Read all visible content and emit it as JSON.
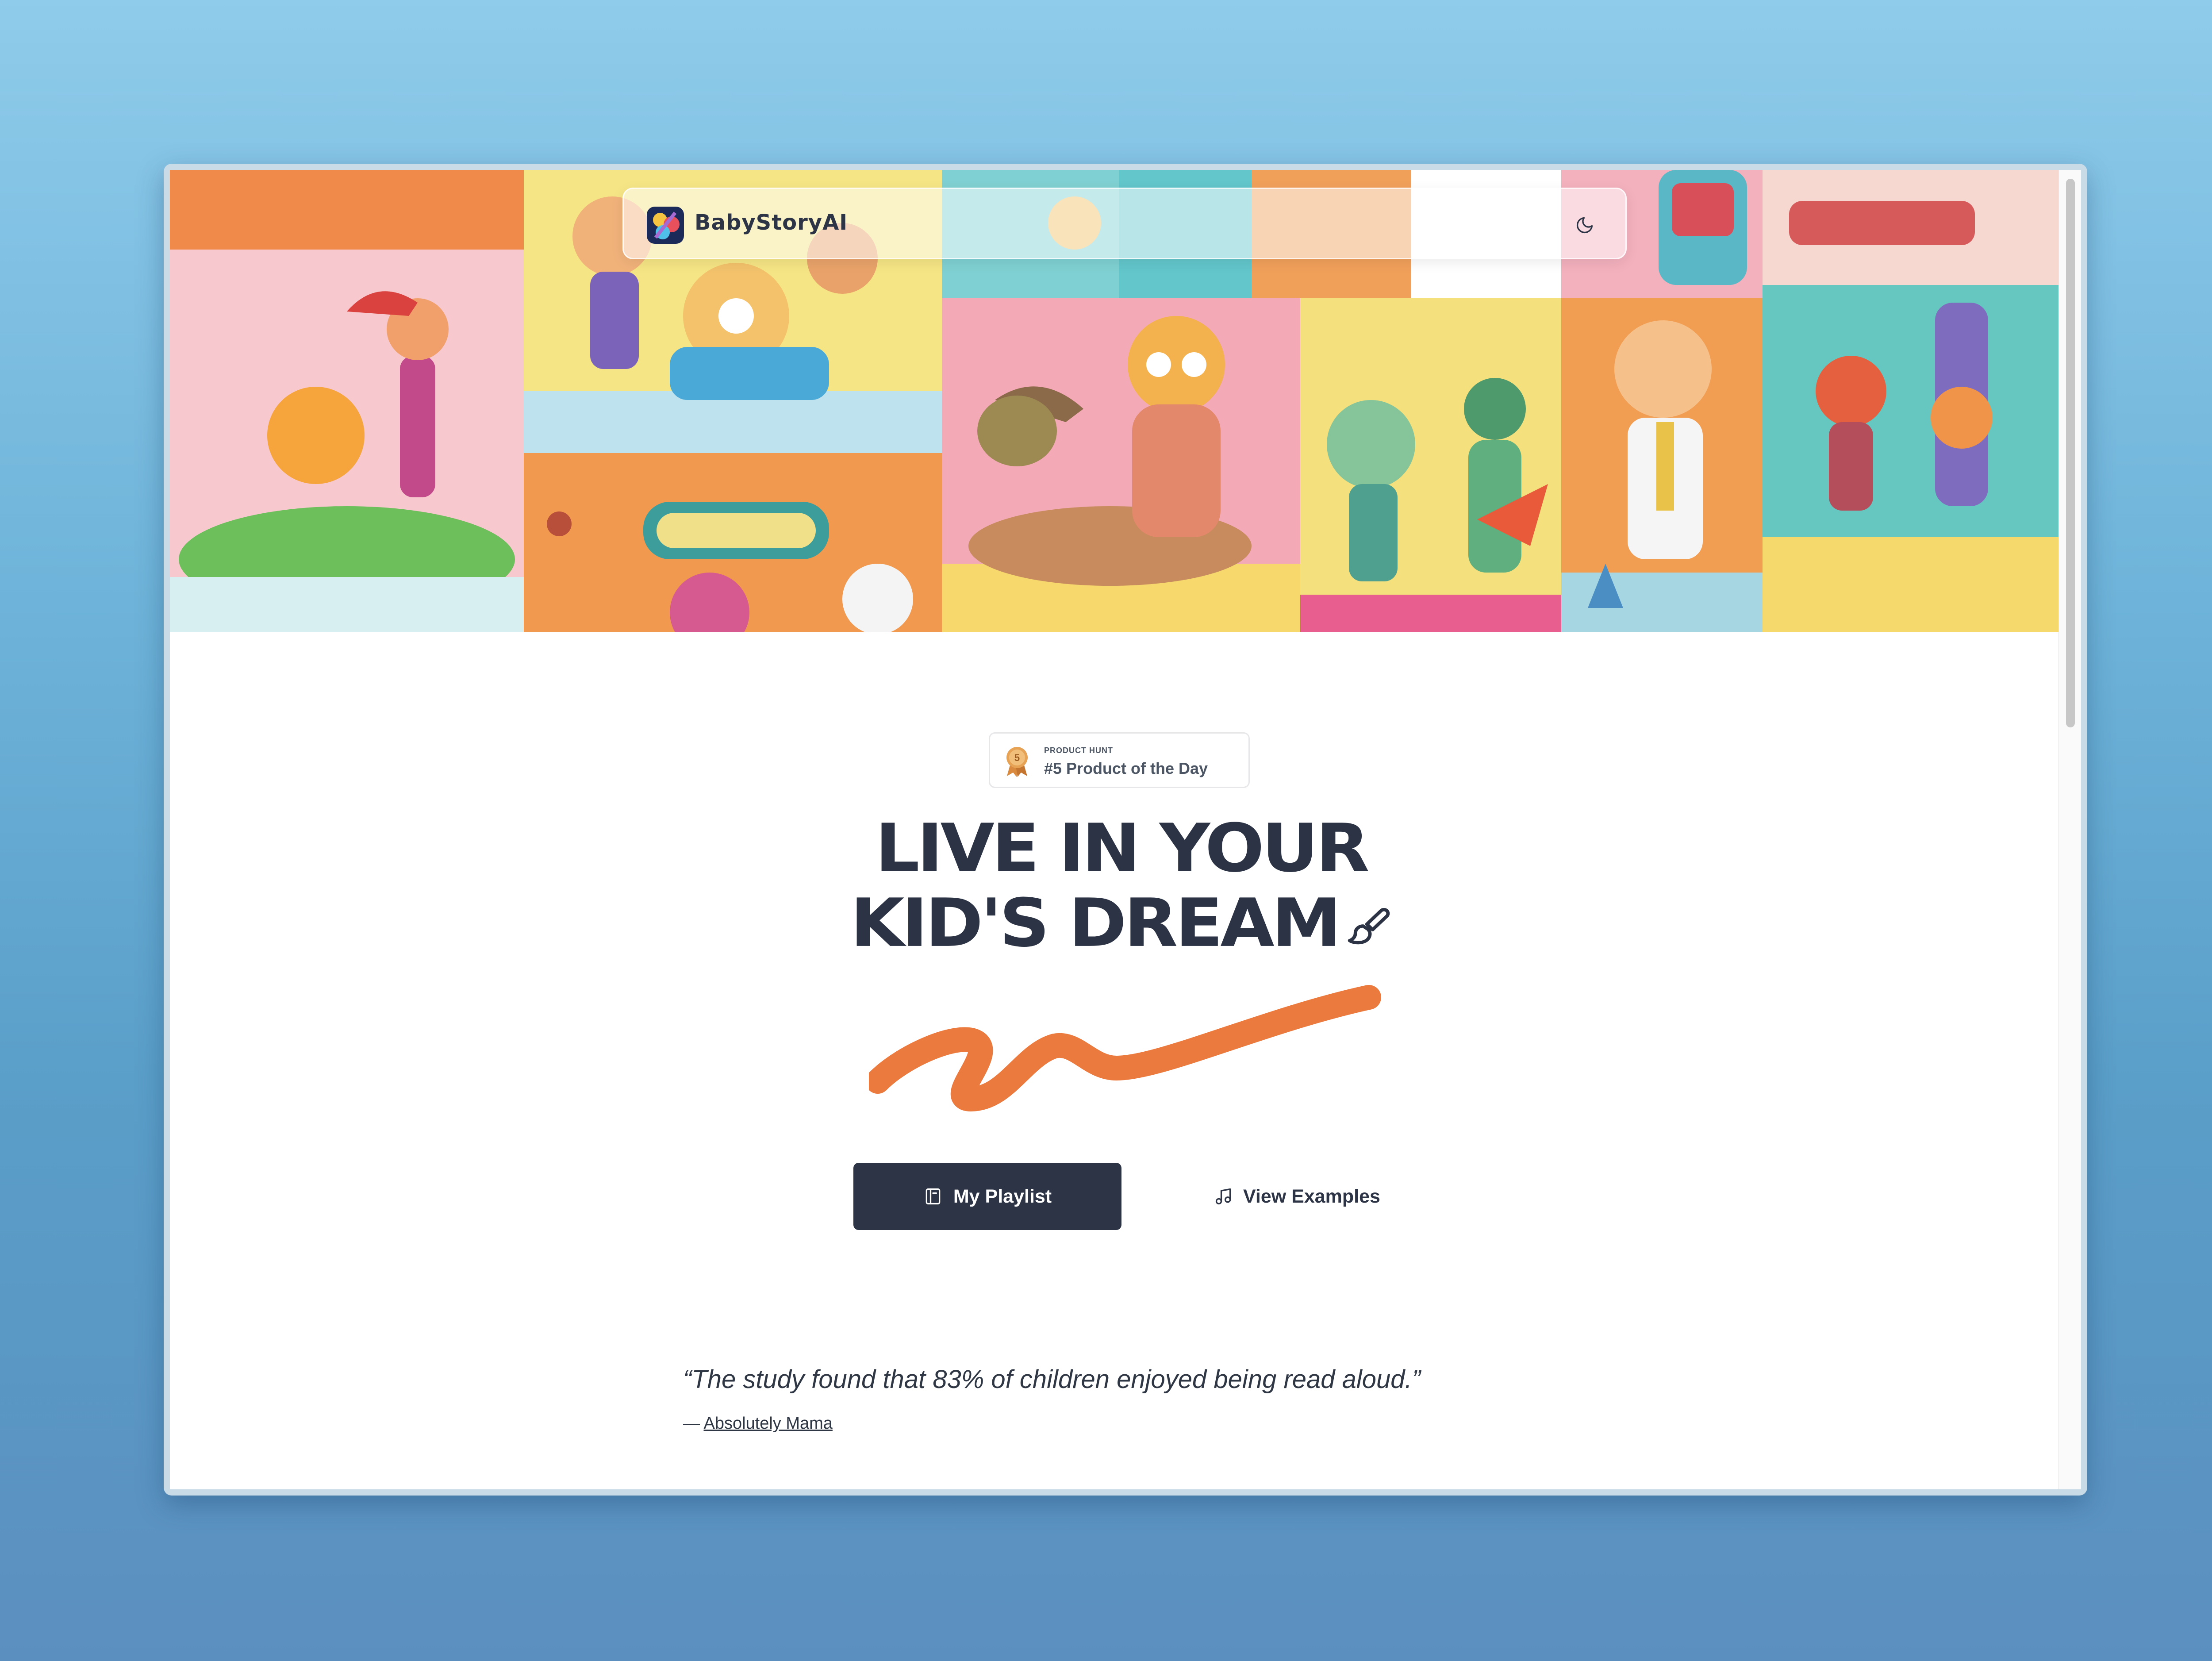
{
  "header": {
    "brand": "BabyStoryAI",
    "logo_icon": "babystory-logo-icon",
    "theme_toggle_icon": "moon-icon"
  },
  "badge": {
    "eyebrow": "PRODUCT HUNT",
    "title": "#5 Product of the Day",
    "medal_number": "5",
    "icon": "medal-icon"
  },
  "hero": {
    "headline_line1": "Live in your",
    "headline_line2": "kid's dream",
    "decor_icon": "paintbrush-icon"
  },
  "actions": {
    "primary_label": "My Playlist",
    "primary_icon": "book-icon",
    "secondary_label": "View Examples",
    "secondary_icon": "music-note-icon"
  },
  "testimonial": {
    "quote": "“The study found that 83% of children enjoyed being read aloud.”",
    "dash": "— ",
    "source": "Absolutely Mama"
  },
  "colors": {
    "dark": "#2c3445",
    "accent_orange": "#eb7a3e",
    "background": "#ffffff"
  }
}
